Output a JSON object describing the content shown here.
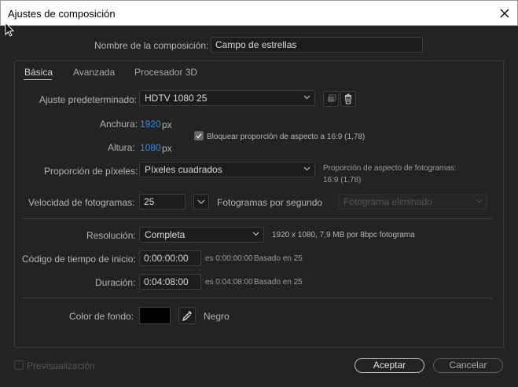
{
  "window": {
    "title": "Ajustes de composición"
  },
  "comp_name": {
    "label": "Nombre de la composición:",
    "value": "Campo de estrellas"
  },
  "tabs": [
    {
      "label": "Básica",
      "active": true
    },
    {
      "label": "Avanzada",
      "active": false
    },
    {
      "label": "Procesador 3D",
      "active": false
    }
  ],
  "preset": {
    "label": "Ajuste predeterminado:",
    "value": "HDTV 1080 25"
  },
  "width": {
    "label": "Anchura:",
    "value": "1920",
    "unit": "px"
  },
  "height": {
    "label": "Altura:",
    "value": "1080",
    "unit": "px"
  },
  "lock_aspect": {
    "label": "Bloquear proporción de aspecto a 16:9 (1,78)",
    "checked": true
  },
  "pixel_aspect": {
    "label": "Proporción de píxeles:",
    "value": "Píxeles cuadrados",
    "frame_aspect_label": "Proporción de aspecto de fotogramas:",
    "frame_aspect_value": "16:9 (1,78)"
  },
  "frame_rate": {
    "label": "Velocidad de fotogramas:",
    "value": "25",
    "unit": "Fotogramas por segundo",
    "drop_frame": "Fotograma eliminado"
  },
  "resolution": {
    "label": "Resolución:",
    "value": "Completa",
    "info": "1920 x 1080, 7,9 MB por 8bpc fotograma"
  },
  "start_timecode": {
    "label": "Código de tiempo de inicio:",
    "value": "0:00:00:00",
    "info1": "es 0:00:00:00",
    "info2": "Basado en 25"
  },
  "duration": {
    "label": "Duración:",
    "value": "0:04:08:00",
    "info1": "es 0:04:08:00",
    "info2": "Basado en 25"
  },
  "background": {
    "label": "Color de fondo:",
    "color_name": "Negro",
    "color": "#000000"
  },
  "footer": {
    "preview_label": "Previsualización",
    "ok_label": "Aceptar",
    "cancel_label": "Cancelar"
  }
}
